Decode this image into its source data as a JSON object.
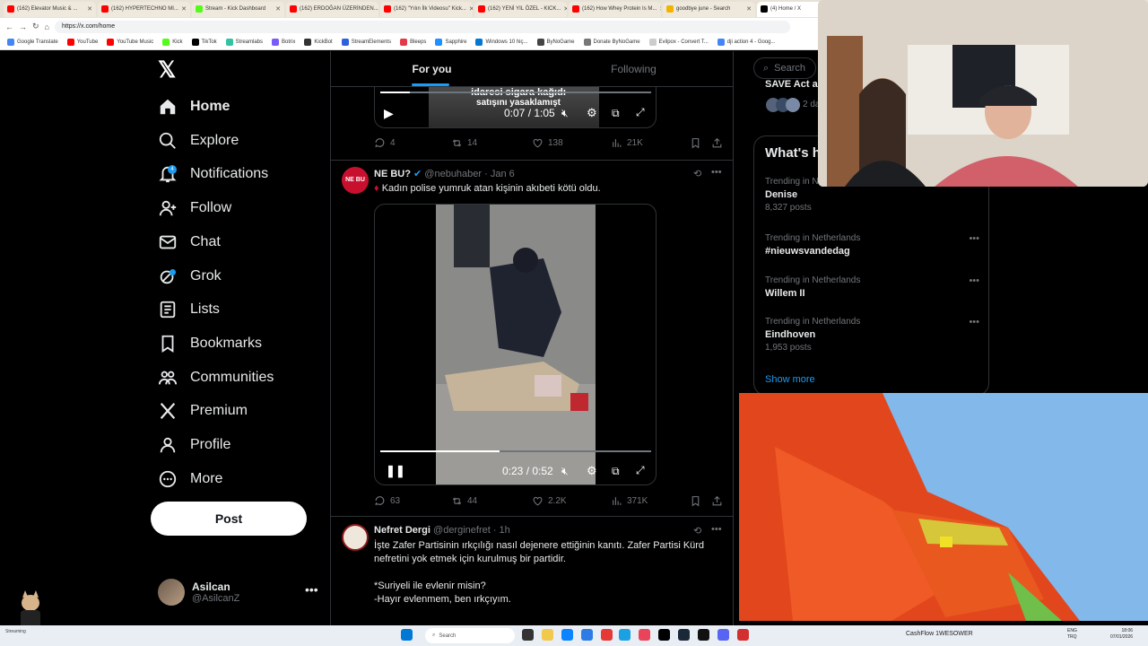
{
  "browser": {
    "tabs": [
      {
        "title": "(162) Elevator Music & ...",
        "color": "#ff0000"
      },
      {
        "title": "(162) HYPERTECHNO MI...",
        "color": "#ff0000"
      },
      {
        "title": "Stream - Kick Dashboard",
        "color": "#53fc18"
      },
      {
        "title": "(162) ERDOĞAN ÜZERİNDEN...",
        "color": "#ff0000"
      },
      {
        "title": "(162) \"Yılın İlk Videosu\" Kick...",
        "color": "#ff0000"
      },
      {
        "title": "(162) YENİ YIL ÖZEL - KICK...",
        "color": "#ff0000"
      },
      {
        "title": "(162) How Whey Protein Is M...",
        "color": "#ff0000"
      },
      {
        "title": "goodbye june - Search",
        "color": "#f0b400"
      },
      {
        "title": "(4) Home / X",
        "color": "#000000"
      }
    ],
    "url": "https://x.com/home",
    "bookmarks": [
      {
        "label": "Google Translate",
        "color": "#4285f4"
      },
      {
        "label": "YouTube",
        "color": "#ff0000"
      },
      {
        "label": "YouTube Music",
        "color": "#ff0000"
      },
      {
        "label": "Kick",
        "color": "#53fc18"
      },
      {
        "label": "TikTok",
        "color": "#000000"
      },
      {
        "label": "Streamlabs",
        "color": "#31c3a2"
      },
      {
        "label": "Botrix",
        "color": "#7a5af8"
      },
      {
        "label": "KickBot",
        "color": "#333333"
      },
      {
        "label": "StreamElements",
        "color": "#2e61de"
      },
      {
        "label": "Bleeps",
        "color": "#e63946"
      },
      {
        "label": "Sapphire",
        "color": "#1e90ff"
      },
      {
        "label": "Windows 10 hiç...",
        "color": "#0078d4"
      },
      {
        "label": "ByNoGame",
        "color": "#444444"
      },
      {
        "label": "Donate ByNoGame",
        "color": "#777777"
      },
      {
        "label": "Evilpox - Convert T...",
        "color": "#cccccc"
      },
      {
        "label": "dji action 4 - Goog...",
        "color": "#4285f4"
      }
    ]
  },
  "nav": {
    "items": [
      {
        "label": "Home",
        "icon": "home-icon"
      },
      {
        "label": "Explore",
        "icon": "search-icon"
      },
      {
        "label": "Notifications",
        "icon": "bell-icon",
        "badge": "4"
      },
      {
        "label": "Follow",
        "icon": "follow-icon"
      },
      {
        "label": "Chat",
        "icon": "mail-icon"
      },
      {
        "label": "Grok",
        "icon": "grok-icon"
      },
      {
        "label": "Lists",
        "icon": "list-icon"
      },
      {
        "label": "Bookmarks",
        "icon": "bookmark-icon"
      },
      {
        "label": "Communities",
        "icon": "communities-icon"
      },
      {
        "label": "Premium",
        "icon": "x-logo-icon"
      },
      {
        "label": "Profile",
        "icon": "user-icon"
      },
      {
        "label": "More",
        "icon": "more-circle-icon"
      }
    ],
    "post_label": "Post",
    "account": {
      "name": "Asilcan",
      "handle": "@AsilcanZ"
    }
  },
  "feed": {
    "tabs": [
      "For you",
      "Following"
    ],
    "post0": {
      "caption_line1": "idaresi sigara kağıdı",
      "caption_line2": "satışını yasaklamışt",
      "time": "0:07 / 1:05",
      "progress": 0.11,
      "replies": "4",
      "reposts": "14",
      "likes": "138",
      "views": "21K"
    },
    "post1": {
      "name": "NE BU?",
      "handle": "@nebuhaber · Jan 6",
      "avatar_text": "NE BU",
      "text": "Kadın polise yumruk atan kişinin akıbeti kötü oldu.",
      "time": "0:23 / 0:52",
      "progress": 0.44,
      "replies": "63",
      "reposts": "44",
      "likes": "2.2K",
      "views": "371K"
    },
    "post2": {
      "name": "Nefret Dergi",
      "handle": "@derginefret · 1h",
      "text1": "İşte Zafer Partisinin ırkçılığı nasıl dejenere ettiğinin kanıtı. Zafer Partisi Kürd nefretini yok etmek için kurulmuş bir partidir.",
      "text2": "*Suriyeli ile evlenir misin?",
      "text3": "-Hayır evlenmem, ben ırkçıyım."
    }
  },
  "right": {
    "search_placeholder": "Search",
    "save_title": "SAVE Act a",
    "save_meta": "2 da",
    "trends_title": "What's happening",
    "trends": [
      {
        "context": "Trending in Netherlands",
        "name": "Denise",
        "count": "8,327 posts"
      },
      {
        "context": "Trending in Netherlands",
        "name": "#nieuwsvandedag",
        "count": ""
      },
      {
        "context": "Trending in Netherlands",
        "name": "Willem II",
        "count": ""
      },
      {
        "context": "Trending in Netherlands",
        "name": "Eindhoven",
        "count": "1,953 posts"
      }
    ],
    "show_more": "Show more"
  },
  "taskbar": {
    "search": "Search",
    "tray": "CashFlow 1WESOWER",
    "lang1": "ENG",
    "lang2": "TRQ",
    "time": "18:06",
    "date": "07/01/2026",
    "weather": "Streaming"
  },
  "colors": {
    "accent": "#1d9bf0",
    "background": "#000000",
    "border": "#2f3336",
    "muted": "#71767b"
  }
}
